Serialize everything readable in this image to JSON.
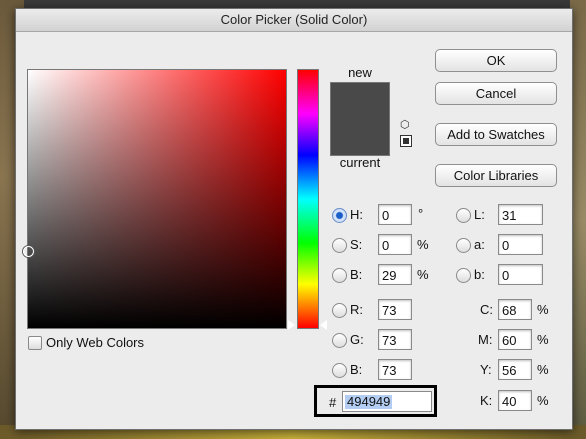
{
  "window": {
    "title": "Color Picker (Solid Color)"
  },
  "buttons": {
    "ok": "OK",
    "cancel": "Cancel",
    "add_to_swatches": "Add to Swatches",
    "color_libraries": "Color Libraries"
  },
  "swatch": {
    "new_label": "new",
    "current_label": "current",
    "new_color": "#494949",
    "current_color": "#494949"
  },
  "options": {
    "only_web_colors": "Only Web Colors"
  },
  "hsb": {
    "h": {
      "label": "H:",
      "value": "0",
      "unit": "°",
      "selected": true
    },
    "s": {
      "label": "S:",
      "value": "0",
      "unit": "%"
    },
    "b": {
      "label": "B:",
      "value": "29",
      "unit": "%"
    }
  },
  "rgb": {
    "r": {
      "label": "R:",
      "value": "73"
    },
    "g": {
      "label": "G:",
      "value": "73"
    },
    "b": {
      "label": "B:",
      "value": "73"
    }
  },
  "lab": {
    "l": {
      "label": "L:",
      "value": "31"
    },
    "a": {
      "label": "a:",
      "value": "0"
    },
    "b": {
      "label": "b:",
      "value": "0"
    }
  },
  "cmyk": {
    "c": {
      "label": "C:",
      "value": "68",
      "unit": "%"
    },
    "m": {
      "label": "M:",
      "value": "60",
      "unit": "%"
    },
    "y": {
      "label": "Y:",
      "value": "56",
      "unit": "%"
    },
    "k": {
      "label": "K:",
      "value": "40",
      "unit": "%"
    }
  },
  "hex": {
    "prefix": "#",
    "value": "494949"
  },
  "colors": {
    "hue_base": "#ff0000",
    "selected": "#494949"
  },
  "icons": {
    "gamut": "cube-icon",
    "web_safe": "web-safe-square-icon"
  }
}
